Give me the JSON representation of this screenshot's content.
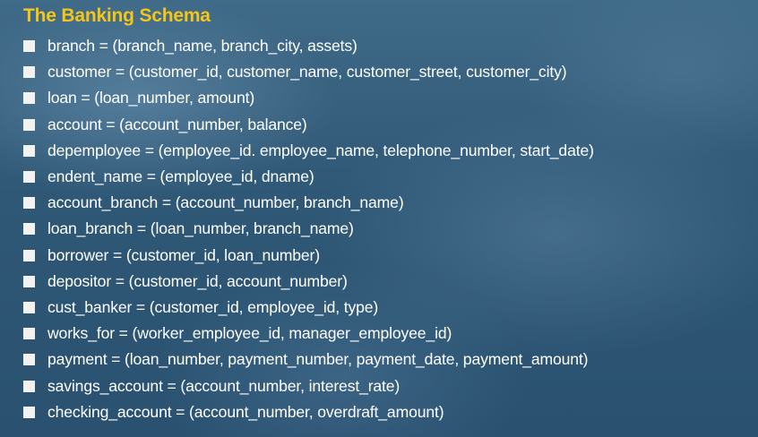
{
  "slide": {
    "title": "The Banking Schema",
    "items": [
      "branch = (branch_name, branch_city, assets)",
      "customer = (customer_id, customer_name, customer_street, customer_city)",
      "loan = (loan_number, amount)",
      "account = (account_number, balance)",
      "depemployee = (employee_id. employee_name, telephone_number, start_date)",
      "endent_name = (employee_id, dname)",
      "account_branch = (account_number, branch_name)",
      "loan_branch = (loan_number, branch_name)",
      "borrower = (customer_id, loan_number)",
      "depositor = (customer_id, account_number)",
      "cust_banker = (customer_id, employee_id, type)",
      "works_for = (worker_employee_id, manager_employee_id)",
      "payment = (loan_number, payment_number, payment_date, payment_amount)",
      "savings_account = (account_number, interest_rate)",
      "checking_account = (account_number, overdraft_amount)"
    ]
  },
  "colors": {
    "title": "#f5c518",
    "text": "#ffffff",
    "bullet": "#f2f2f2",
    "background": "#2f5876"
  },
  "icons": {
    "bullet": "square-bullet-icon"
  }
}
